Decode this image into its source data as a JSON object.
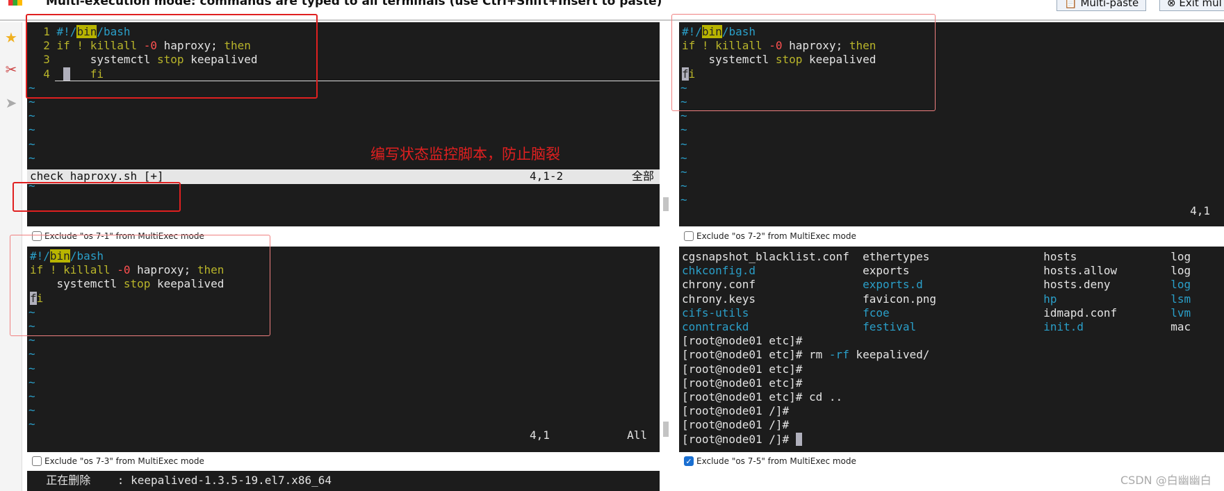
{
  "header": {
    "title": "Multi-execution mode: commands are typed to all terminals (use Ctrl+Shift+Insert to paste)",
    "multi_paste": "Multi-paste",
    "exit_multi": "Exit mul"
  },
  "sidebar": {
    "icons": [
      "star-icon",
      "tools-icon",
      "send-icon"
    ]
  },
  "panes": [
    {
      "lines": [
        [
          [
            "  1 ",
            "n"
          ],
          [
            "#!/",
            "c"
          ],
          [
            "bin",
            "hl"
          ],
          [
            "/bash",
            "c"
          ]
        ],
        [
          [
            "  2 ",
            "n"
          ],
          [
            "if ! killall ",
            "y"
          ],
          [
            "-0",
            "r"
          ],
          [
            " haproxy; ",
            "w"
          ],
          [
            "then",
            "y"
          ]
        ],
        [
          [
            "  3 ",
            "n"
          ],
          [
            "     systemctl ",
            "w"
          ],
          [
            "stop",
            "y"
          ],
          [
            " keepalived",
            "w"
          ]
        ],
        [
          [
            "  4 ",
            "n"
          ],
          [
            " ",
            "w"
          ],
          [
            " ",
            "cur"
          ],
          [
            "   ",
            "w"
          ],
          [
            "fi",
            "y"
          ]
        ]
      ],
      "tildes": 8,
      "status": {
        "file": "check_haproxy.sh [+]",
        "pos": "4,1-2",
        "scope": "全部"
      },
      "exclude_label": "Exclude \"os 7-1\" from MultiExec mode",
      "excluded": false
    },
    {
      "lines": [
        [
          [
            "#!/",
            "c"
          ],
          [
            "bin",
            "hl"
          ],
          [
            "/bash",
            "c"
          ]
        ],
        [
          [
            "if ! killall ",
            "y"
          ],
          [
            "-0",
            "r"
          ],
          [
            " haproxy; ",
            "w"
          ],
          [
            "then",
            "y"
          ]
        ],
        [
          [
            "    systemctl ",
            "w"
          ],
          [
            "stop",
            "y"
          ],
          [
            " keepalived",
            "w"
          ]
        ],
        [
          [
            "f",
            "cur"
          ],
          [
            "i",
            "y"
          ]
        ]
      ],
      "tildes": 9,
      "status": {
        "pos": "4,1"
      },
      "exclude_label": "Exclude \"os 7-2\" from MultiExec mode",
      "excluded": false
    },
    {
      "lines": [
        [
          [
            "#!/",
            "c"
          ],
          [
            "bin",
            "hl"
          ],
          [
            "/bash",
            "c"
          ]
        ],
        [
          [
            "if ! killall ",
            "y"
          ],
          [
            "-0",
            "r"
          ],
          [
            " haproxy; ",
            "w"
          ],
          [
            "then",
            "y"
          ]
        ],
        [
          [
            "    systemctl ",
            "w"
          ],
          [
            "stop",
            "y"
          ],
          [
            " keepalived",
            "w"
          ]
        ],
        [
          [
            "f",
            "cur"
          ],
          [
            "i",
            "y"
          ]
        ]
      ],
      "tildes": 9,
      "status": {
        "pos": "4,1",
        "scope": "All"
      },
      "exclude_label": "Exclude \"os 7-3\" from MultiExec mode",
      "excluded": false
    },
    {
      "lines": [
        [
          [
            "cgsnapshot_blacklist.conf  ",
            "w"
          ],
          [
            "ethertypes                 ",
            "w"
          ],
          [
            "hosts              ",
            "w"
          ],
          [
            "log",
            "w"
          ]
        ],
        [
          [
            "chkconfig.d                ",
            "c"
          ],
          [
            "exports                    ",
            "w"
          ],
          [
            "hosts.allow        ",
            "w"
          ],
          [
            "log",
            "w"
          ]
        ],
        [
          [
            "chrony.conf                ",
            "w"
          ],
          [
            "exports.d                  ",
            "c"
          ],
          [
            "hosts.deny         ",
            "w"
          ],
          [
            "log",
            "c"
          ]
        ],
        [
          [
            "chrony.keys                ",
            "w"
          ],
          [
            "favicon.png                ",
            "w"
          ],
          [
            "hp                 ",
            "c"
          ],
          [
            "lsm",
            "c"
          ]
        ],
        [
          [
            "cifs-utils                 ",
            "c"
          ],
          [
            "fcoe                       ",
            "c"
          ],
          [
            "idmapd.conf        ",
            "w"
          ],
          [
            "lvm",
            "c"
          ]
        ],
        [
          [
            "conntrackd                 ",
            "c"
          ],
          [
            "festival                   ",
            "c"
          ],
          [
            "init.d             ",
            "c"
          ],
          [
            "mac",
            "w"
          ]
        ],
        [
          [
            "[root@node01 etc]#",
            "w"
          ]
        ],
        [
          [
            "[root@node01 etc]# rm ",
            "w"
          ],
          [
            "-rf",
            "c"
          ],
          [
            " keepalived/",
            "w"
          ]
        ],
        [
          [
            "[root@node01 etc]#",
            "w"
          ]
        ],
        [
          [
            "[root@node01 etc]#",
            "w"
          ]
        ],
        [
          [
            "[root@node01 etc]# cd ..",
            "w"
          ]
        ],
        [
          [
            "[root@node01 /]#",
            "w"
          ]
        ],
        [
          [
            "[root@node01 /]#",
            "w"
          ]
        ],
        [
          [
            "[root@node01 /]# ",
            "w"
          ],
          [
            " ",
            "cur"
          ]
        ]
      ],
      "tildes": 0,
      "exclude_label": "Exclude \"os 7-5\" from MultiExec mode",
      "excluded": true
    }
  ],
  "bottom_pane": {
    "line": "  正在删除    : keepalived-1.3.5-19.el7.x86_64"
  },
  "annotation": "编写状态监控脚本，防止脑裂",
  "watermark": "CSDN @白幽幽白",
  "colors": {
    "terminal_bg": "#1c1c1c",
    "keyword": "#b9b52a",
    "directory": "#2a9fc9",
    "annotation": "#e02020"
  }
}
